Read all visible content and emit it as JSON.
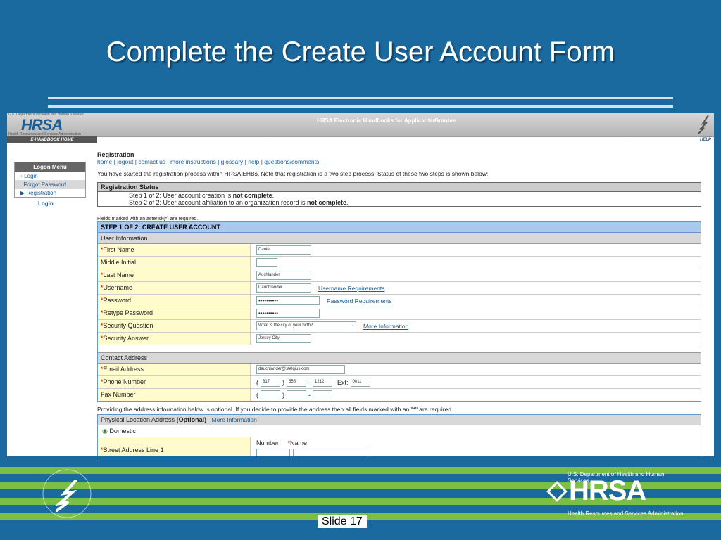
{
  "slide": {
    "title": "Complete the Create User Account Form",
    "number": "Slide 17"
  },
  "app": {
    "logo_agency": "U.S. Department of Health and Human Services",
    "logo_word": "HRSA",
    "logo_tagline": "Health Resources and Services Administration",
    "handbook_tab": "E-HANDBOOK HOME",
    "title": "HRSA Electronic Handbooks for Applicants/Grantee",
    "help": "HELP"
  },
  "logon_menu": {
    "title": "Logon Menu",
    "items": [
      "Login",
      "Forgot Password",
      "Registration"
    ],
    "current": "Login"
  },
  "main": {
    "heading": "Registration",
    "links": [
      "home",
      "logout",
      "contact us",
      "more instructions",
      "glossary",
      "help",
      "questions/comments"
    ],
    "intro": "You have started the registration process within HRSA EHBs. Note that registration is a two step process. Status of these two steps is shown below:",
    "status_title": "Registration Status",
    "status_1_prefix": "Step 1 of 2: User account creation is",
    "status_1_state": "not complete",
    "status_2_prefix": "Step 2 of 2: User account affiliation to an organization record is",
    "status_2_state": "not complete",
    "required_note": "Fields marked with an asterisk(*) are required."
  },
  "form": {
    "step_title": "STEP 1 OF 2: CREATE USER ACCOUNT",
    "user_info_title": "User Information",
    "fields": {
      "first_name": {
        "label": "First Name",
        "value": "Daniel"
      },
      "middle_initial": {
        "label": "Middle Initial",
        "value": ""
      },
      "last_name": {
        "label": "Last Name",
        "value": "Auchlander"
      },
      "username": {
        "label": "Username",
        "value": "Dauchlander",
        "link": "Username Requirements"
      },
      "password": {
        "label": "Password",
        "value": "••••••••••",
        "link": "Password Requirements"
      },
      "retype_password": {
        "label": "Retype Password",
        "value": "••••••••••"
      },
      "security_question": {
        "label": "Security Question",
        "value": "What is the city of your birth?",
        "link": "More Information"
      },
      "security_answer": {
        "label": "Security Answer",
        "value": "Jersey City"
      }
    },
    "contact_title": "Contact Address",
    "contact": {
      "email": {
        "label": "Email Address",
        "value": "dauchlander@stelgius.com"
      },
      "phone": {
        "label": "Phone Number",
        "area": "617",
        "prefix": "555",
        "line": "1212",
        "ext_label": "Ext:",
        "ext": "0011"
      },
      "fax": {
        "label": "Fax Number"
      }
    },
    "optional_note": "Providing the address information below is optional. If you decide to provide the address then all fields marked with an \"*\" are required.",
    "physical_title": "Physical Location Address",
    "physical_optional": "(Optional)",
    "physical_link": "More Information",
    "domestic_label": "Domestic",
    "street": {
      "label": "Street Address Line 1",
      "number_label": "Number",
      "name_label": "Name"
    }
  },
  "footer": {
    "agency_line": "U.S. Department of Health and Human Services",
    "logo_word": "HRSA",
    "tagline": "Health Resources and Services Administration"
  },
  "colors": {
    "slide_bg": "#1a6aa0",
    "band_green": "#7cbf44",
    "label_bg": "#fffbcc",
    "link": "#1b5d96"
  }
}
